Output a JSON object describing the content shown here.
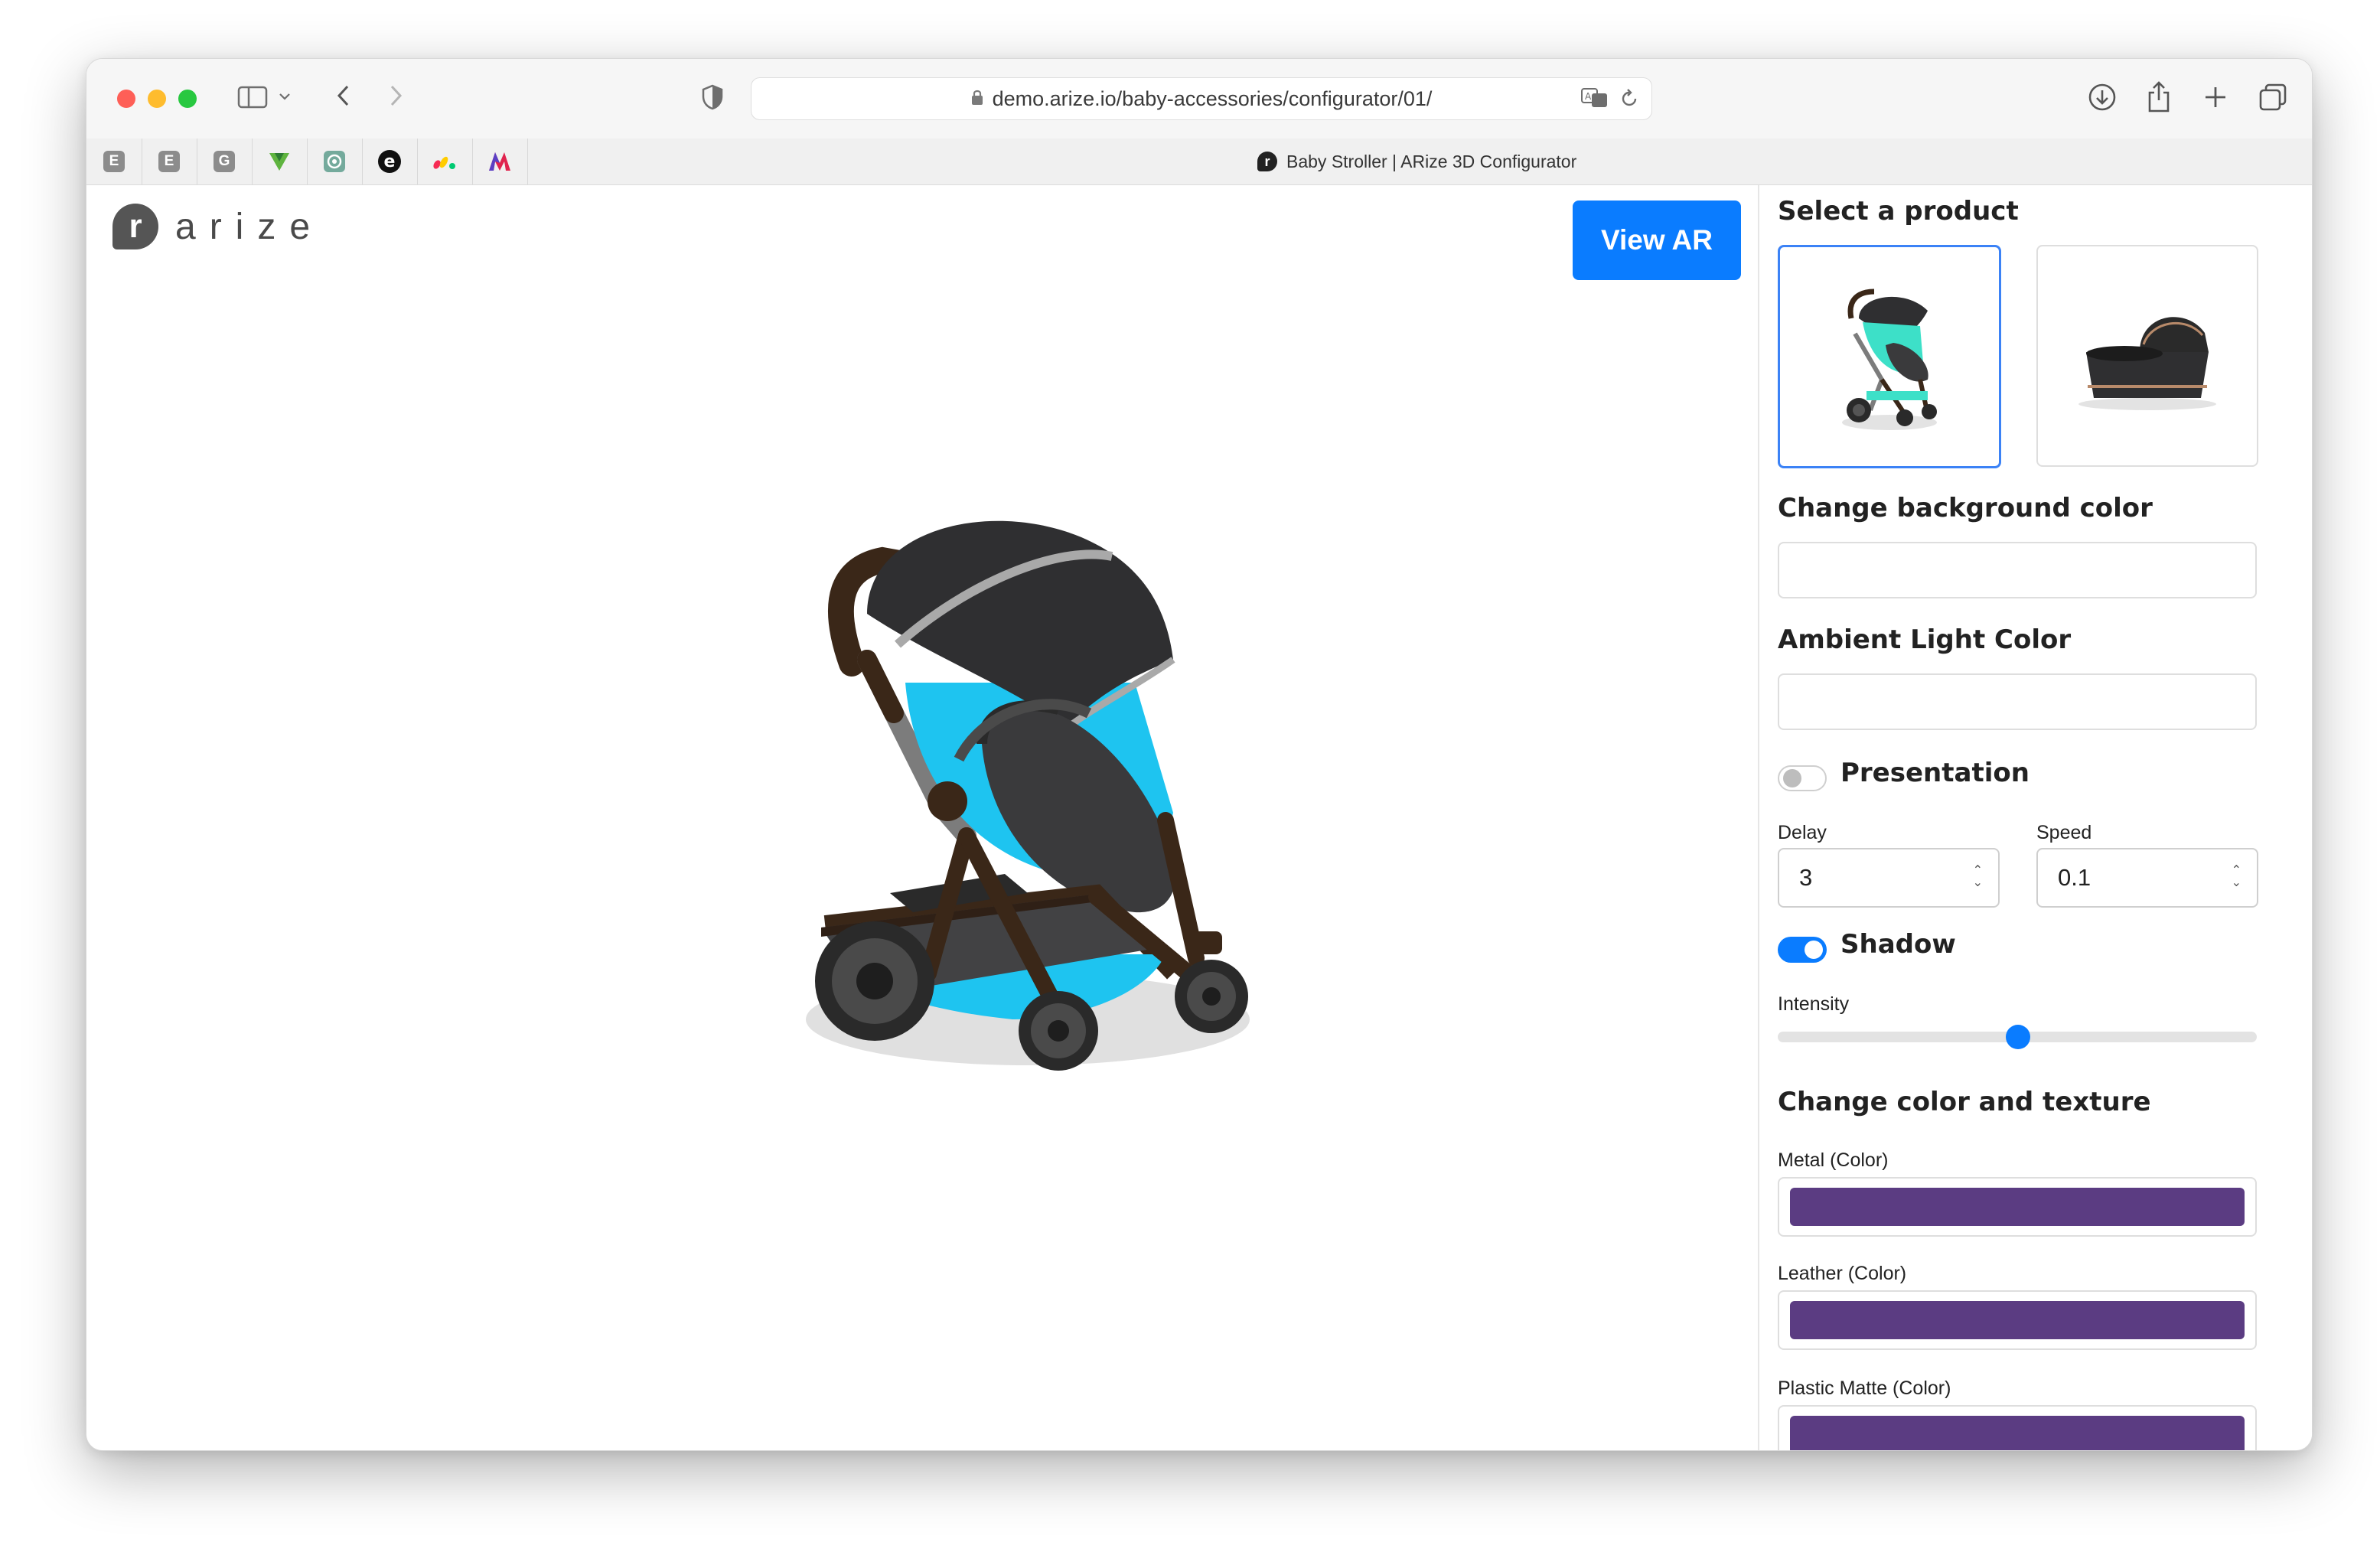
{
  "browser": {
    "url": "demo.arize.io/baby-accessories/configurator/01/",
    "tab_title": "Baby Stroller | ARize 3D Configurator",
    "favorites": [
      "E",
      "E",
      "G"
    ]
  },
  "header": {
    "logo_mark": "r",
    "logo_text": "arize",
    "view_ar_label": "View AR"
  },
  "panel": {
    "select_product_title": "Select a product",
    "change_bg_title": "Change background color",
    "ambient_title": "Ambient Light Color",
    "presentation_label": "Presentation",
    "presentation_on": false,
    "delay_label": "Delay",
    "delay_value": "3",
    "speed_label": "Speed",
    "speed_value": "0.1",
    "shadow_label": "Shadow",
    "shadow_on": true,
    "intensity_label": "Intensity",
    "intensity_value": 0.5,
    "texture_title": "Change color and texture",
    "metal_label": "Metal (Color)",
    "leather_label": "Leather (Color)",
    "plastic_label": "Plastic Matte (Color)"
  },
  "colors": {
    "accent": "#0a7cff",
    "swatch_purple": "#5b3c82",
    "stroller_body": "#1ec4f0",
    "stroller_fabric": "#2f2f31",
    "stroller_frame": "#3a2718"
  }
}
